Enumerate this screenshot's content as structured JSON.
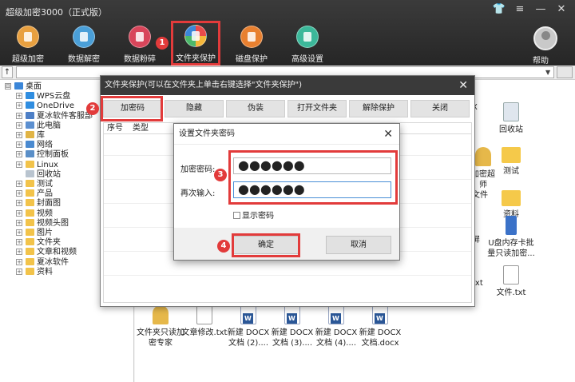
{
  "app": {
    "title": "超级加密3000（正式版）"
  },
  "window_controls": {
    "shirt": "👕",
    "menu": "≡",
    "minimize": "—",
    "close": "✕"
  },
  "toolbar": [
    {
      "label": "超级加密",
      "color": "#e8a040",
      "icon": "lock-icon"
    },
    {
      "label": "数据解密",
      "color": "#4a9fd8",
      "icon": "unlock-icon"
    },
    {
      "label": "数据粉碎",
      "color": "#d8455a",
      "icon": "scissors-icon"
    },
    {
      "label": "文件夹保护",
      "color": "#f0f0f0",
      "icon": "folder-protect-icon",
      "active": true
    },
    {
      "label": "磁盘保护",
      "color": "#e88030",
      "icon": "shield-icon"
    },
    {
      "label": "高级设置",
      "color": "#3cb89a",
      "icon": "gear-icon"
    }
  ],
  "help_label": "帮助",
  "address": {
    "up": "↑",
    "dropdown": "▼"
  },
  "tree": [
    {
      "label": "桌面",
      "color": "#3b86d8",
      "expander": "⊟"
    },
    {
      "label": "WPS云盘",
      "color": "#2f8de0",
      "expander": "+"
    },
    {
      "label": "OneDrive",
      "color": "#2f8de0",
      "expander": "+"
    },
    {
      "label": "夏冰软件客服部",
      "color": "#4d7fc6",
      "expander": "+"
    },
    {
      "label": "此电脑",
      "color": "#5b8fd0",
      "expander": "+"
    },
    {
      "label": "库",
      "color": "#e1b445",
      "expander": "+"
    },
    {
      "label": "网络",
      "color": "#4a8ad0",
      "expander": "+"
    },
    {
      "label": "控制面板",
      "color": "#5a8fc8",
      "expander": "+"
    },
    {
      "label": "Linux",
      "color": "#f2c34a",
      "expander": "+"
    },
    {
      "label": "回收站",
      "color": "#b9c4cf",
      "expander": ""
    },
    {
      "label": "测试",
      "color": "#f2c34a",
      "expander": "+"
    },
    {
      "label": "产品",
      "color": "#f2c34a",
      "expander": "+"
    },
    {
      "label": "封面图",
      "color": "#f2c34a",
      "expander": "+"
    },
    {
      "label": "视频",
      "color": "#f2c34a",
      "expander": "+"
    },
    {
      "label": "视频头图",
      "color": "#f2c34a",
      "expander": "+"
    },
    {
      "label": "图片",
      "color": "#f2c34a",
      "expander": "+"
    },
    {
      "label": "文件夹",
      "color": "#f2c34a",
      "expander": "+"
    },
    {
      "label": "文章和视频",
      "color": "#f2c34a",
      "expander": "+"
    },
    {
      "label": "夏冰软件",
      "color": "#f2c34a",
      "expander": "+"
    },
    {
      "label": "资料",
      "color": "#f2c34a",
      "expander": "+"
    }
  ],
  "files_visible": {
    "right_column": [
      {
        "name": "X",
        "kind": "fragment"
      },
      {
        "name": "回收站",
        "kind": "bin"
      },
      {
        "name": "加密超\n师",
        "kind": "lock"
      },
      {
        "name": "测试",
        "kind": "folder"
      },
      {
        "name": "文件",
        "kind": "fragment"
      },
      {
        "name": "资料",
        "kind": "folder"
      },
      {
        "name": "屏",
        "kind": "fragment"
      },
      {
        "name": "U盘内存卡批\n量只读加密...",
        "kind": "usb"
      },
      {
        "name": "txt",
        "kind": "fragment"
      },
      {
        "name": "文件.txt",
        "kind": "txt"
      }
    ],
    "bottom_row": [
      {
        "name": "文件夹只读加\n密专家",
        "kind": "lock"
      },
      {
        "name": "文章修改.txt",
        "kind": "txt"
      },
      {
        "name": "新建 DOCX\n文档 (2)....",
        "kind": "doc"
      },
      {
        "name": "新建 DOCX\n文档 (3)....",
        "kind": "doc"
      },
      {
        "name": "新建 DOCX\n文档 (4)....",
        "kind": "doc"
      },
      {
        "name": "新建 DOCX\n文档.docx",
        "kind": "doc"
      }
    ]
  },
  "folder_dialog": {
    "title": "文件夹保护(可以在文件夹上单击右键选择\"文件夹保护\")",
    "close": "✕",
    "buttons": [
      "加密码",
      "隐藏",
      "伪装",
      "打开文件夹",
      "解除保护",
      "关闭"
    ],
    "columns": [
      "序号",
      "类型"
    ]
  },
  "password_dialog": {
    "title": "设置文件夹密码",
    "close": "✕",
    "password_label": "加密密码:",
    "password_value": "●●●●●●",
    "confirm_label": "再次输入:",
    "confirm_value": "●●●●●●",
    "show_password": "显示密码",
    "ok": "确定",
    "cancel": "取消"
  },
  "callouts": [
    "1",
    "2",
    "3",
    "4"
  ]
}
